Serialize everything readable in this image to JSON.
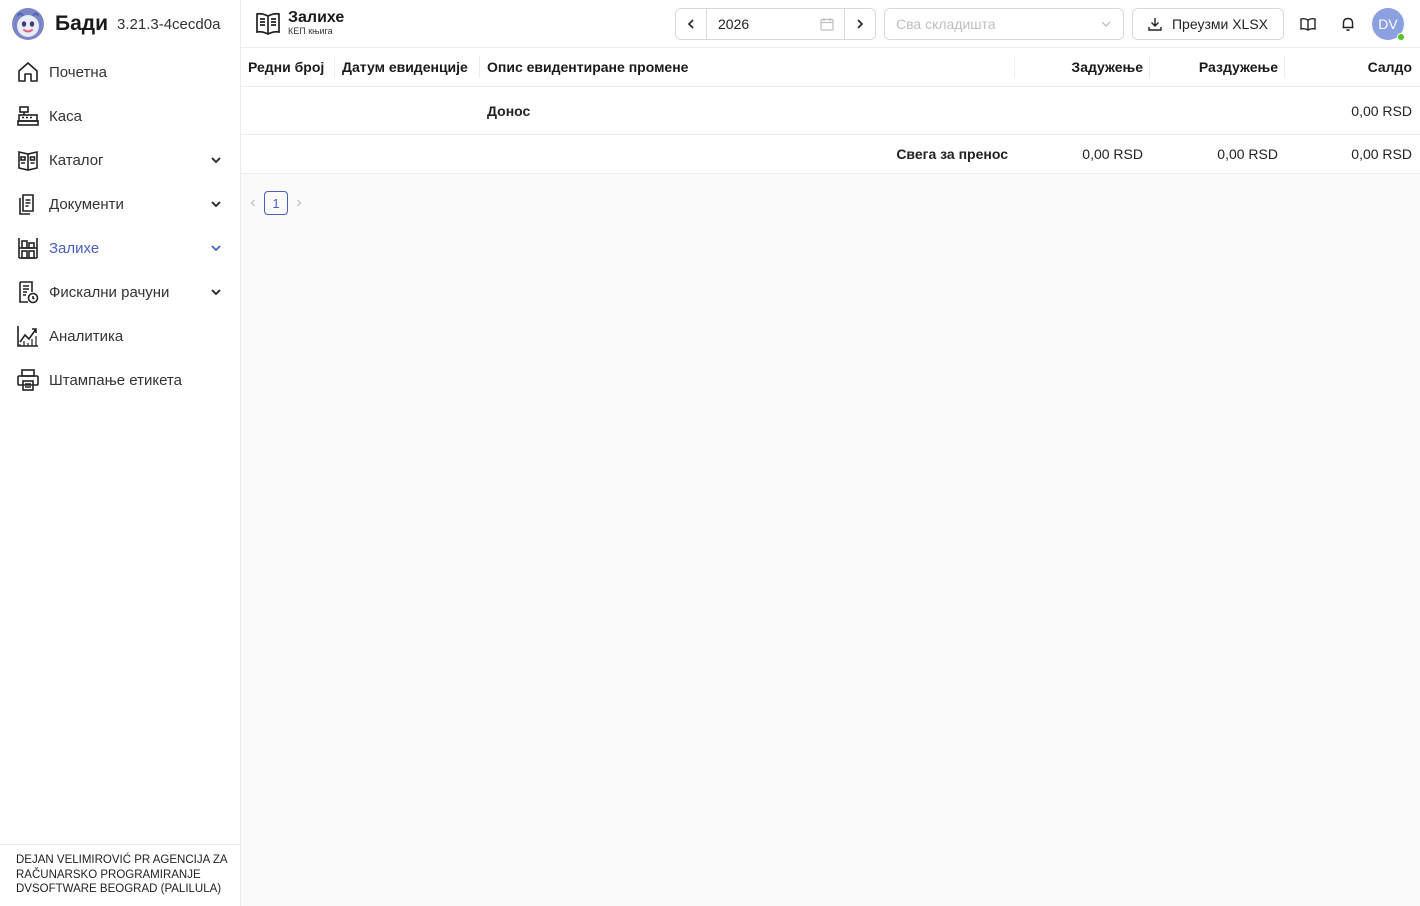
{
  "app": {
    "name": "Бади",
    "version": "3.21.3-4cecd0a"
  },
  "sidebar": {
    "items": [
      {
        "label": "Почетна",
        "icon": "home-icon"
      },
      {
        "label": "Каса",
        "icon": "cash-register-icon"
      },
      {
        "label": "Каталог",
        "icon": "catalog-icon",
        "expandable": true
      },
      {
        "label": "Документи",
        "icon": "documents-icon",
        "expandable": true
      },
      {
        "label": "Залихе",
        "icon": "warehouse-icon",
        "expandable": true,
        "active": true
      },
      {
        "label": "Фискални рачуни",
        "icon": "fiscal-receipt-icon",
        "expandable": true
      },
      {
        "label": "Аналитика",
        "icon": "analytics-icon"
      },
      {
        "label": "Штампање етикета",
        "icon": "printer-icon"
      }
    ],
    "company": "DEJAN VELIMIROVIĆ PR AGENCIJA ZA RAČUNARSKO PROGRAMIRANJE DVSOFTWARE BEOGRAD (PALILULA)"
  },
  "header": {
    "title": "Залихе",
    "subtitle": "КЕП књига",
    "year": "2026",
    "warehouse_placeholder": "Сва складишта",
    "download_label": "Преузми XLSX",
    "avatar_initials": "DV"
  },
  "table": {
    "columns": [
      "Редни број",
      "Датум евиденције",
      "Опис евидентиране промене",
      "Задужење",
      "Раздужење",
      "Салдо"
    ],
    "carry_in": {
      "description": "Донос",
      "balance": "0,00 RSD"
    },
    "total": {
      "label": "Свега за пренос",
      "debit": "0,00 RSD",
      "credit": "0,00 RSD",
      "balance": "0,00 RSD"
    }
  },
  "pagination": {
    "current_page": "1"
  },
  "colors": {
    "accent": "#4a5fc1",
    "online": "#52c41a",
    "avatar": "#8aa0e0"
  }
}
